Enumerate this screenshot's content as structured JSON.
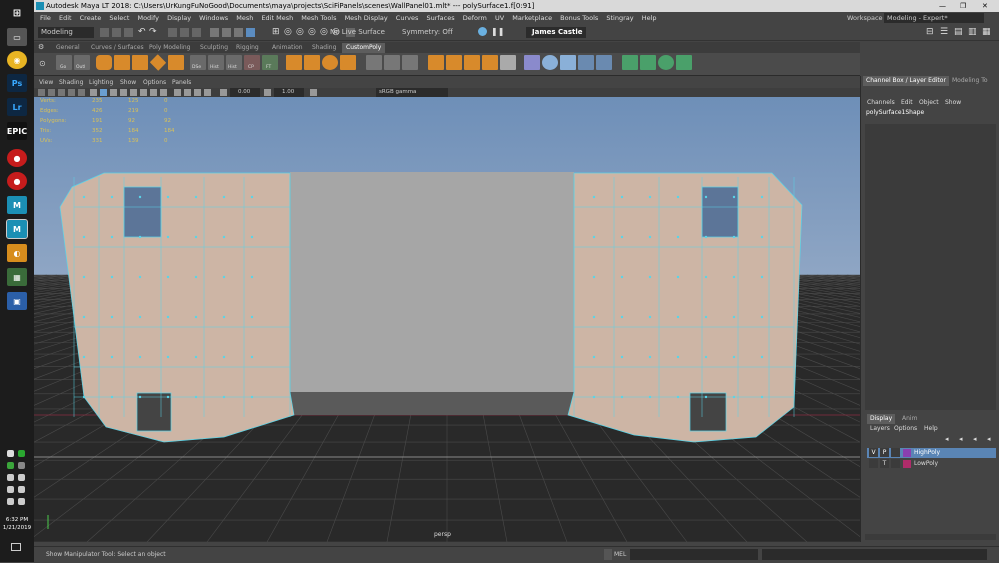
{
  "window": {
    "title": "Autodesk Maya LT 2018: C:\\Users\\UrKungFuNoGood\\Documents\\maya\\projects\\SciFiPanels\\scenes\\WallPanel01.mlt*   ---   polySurface1.f[0:91]"
  },
  "menubar": [
    "File",
    "Edit",
    "Create",
    "Select",
    "Modify",
    "Display",
    "Windows",
    "Mesh",
    "Edit Mesh",
    "Mesh Tools",
    "Mesh Display",
    "Curves",
    "Surfaces",
    "Deform",
    "UV",
    "Marketplace",
    "Bonus Tools",
    "Stingray",
    "Help"
  ],
  "workspace": {
    "label": "Workspace :",
    "value": "Modeling - Expert*"
  },
  "statusline": {
    "mode": "Modeling",
    "live_surface": "No Live Surface",
    "symmetry": "Symmetry: Off",
    "user": "James Castle"
  },
  "shelf": {
    "tabs": [
      "General",
      "Curves / Surfaces",
      "Poly Modeling",
      "Sculpting",
      "Rigging",
      "Animation",
      "Shading",
      "CustomPoly"
    ],
    "active_tab": "CustomPoly",
    "labeled_buttons": [
      "Go",
      "Outl",
      "DSe",
      "Hist",
      "Hist",
      "CP",
      "FT"
    ]
  },
  "viewport_menu": [
    "View",
    "Shading",
    "Lighting",
    "Show",
    "Options",
    "Panels"
  ],
  "viewport_toolbar": {
    "exposure": "0.00",
    "gamma": "1.00",
    "color_space": "sRGB gamma"
  },
  "hud": [
    {
      "label": "Verts:",
      "a": "235",
      "b": "125",
      "c": "0"
    },
    {
      "label": "Edges:",
      "a": "426",
      "b": "219",
      "c": "0"
    },
    {
      "label": "Polygons:",
      "a": "191",
      "b": "92",
      "c": "92"
    },
    {
      "label": "Tris:",
      "a": "352",
      "b": "184",
      "c": "184"
    },
    {
      "label": "UVs:",
      "a": "331",
      "b": "139",
      "c": "0"
    }
  ],
  "camera_label": "persp",
  "channel_box": {
    "tabs": [
      "Channel Box / Layer Editor",
      "Modeling To"
    ],
    "menus": [
      "Channels",
      "Edit",
      "Object",
      "Show"
    ],
    "object": "polySurface1Shape"
  },
  "layer_editor": {
    "tabs": [
      "Display",
      "Anim"
    ],
    "menus": [
      "Layers",
      "Options",
      "Help"
    ],
    "layers": [
      {
        "v": "V",
        "p": "P",
        "name": "HighPoly",
        "color": "#8a3fb0"
      },
      {
        "v": "",
        "p": "T",
        "name": "LowPoly",
        "color": "#b02c6a"
      }
    ]
  },
  "helpline": {
    "text": "Show Manipulator Tool: Select an object",
    "mel_label": "MEL"
  },
  "clock": {
    "time": "6:32 PM",
    "date": "1/21/2019"
  },
  "colors": {
    "sky_top": "#6e8fb8",
    "sky_bottom": "#8fa6c4",
    "ground": "#292929",
    "mesh": "#cdb5a5",
    "wire": "#59d4e8"
  }
}
